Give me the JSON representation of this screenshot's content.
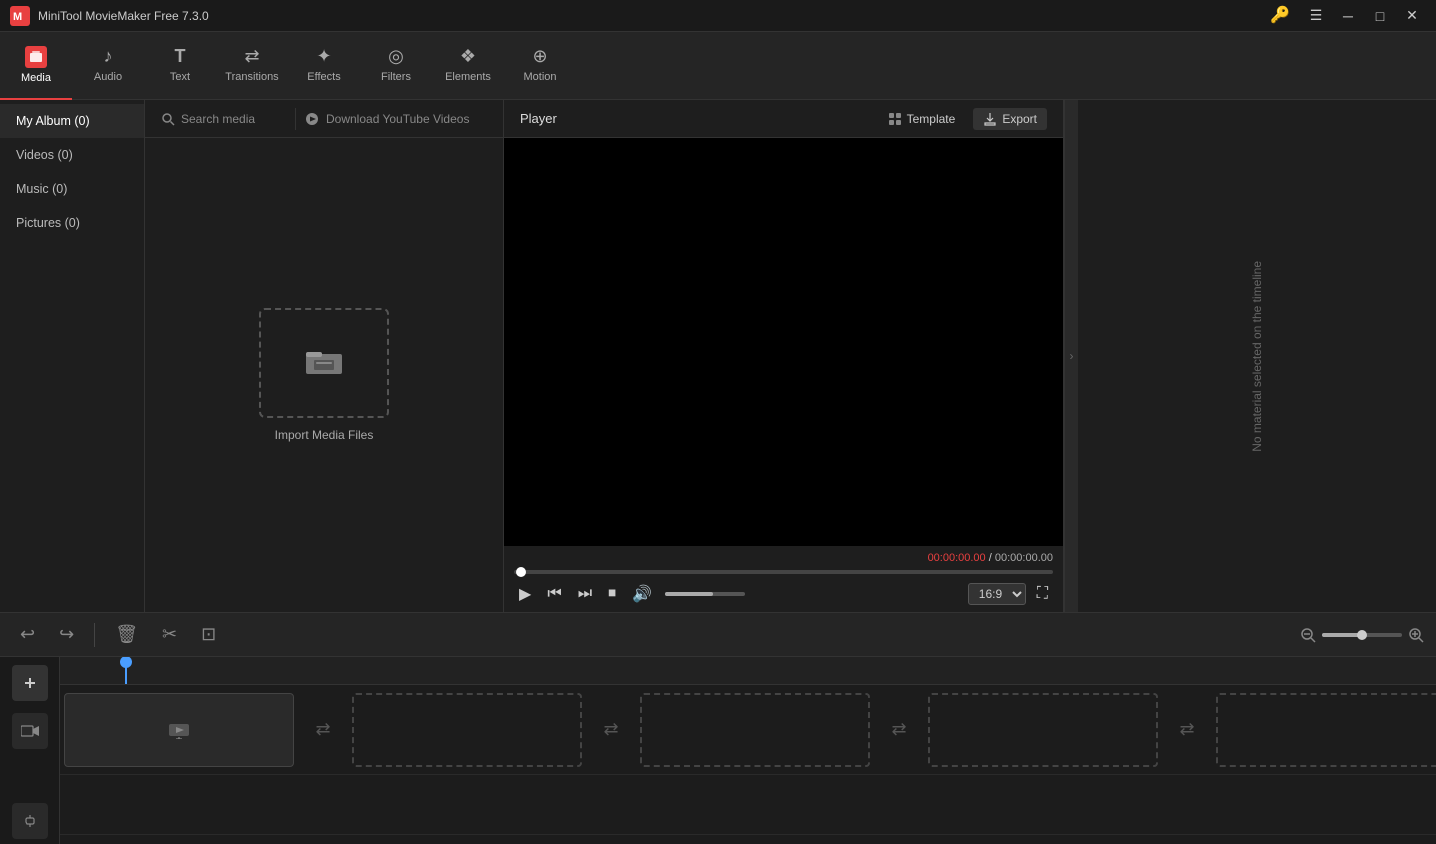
{
  "app": {
    "title": "MiniTool MovieMaker Free 7.3.0"
  },
  "titlebar": {
    "menu_icon": "☰",
    "minimize": "─",
    "maximize": "□",
    "close": "✕",
    "key_icon": "🔑"
  },
  "toolbar": {
    "items": [
      {
        "id": "media",
        "label": "Media",
        "icon": "M",
        "active": true
      },
      {
        "id": "audio",
        "label": "Audio",
        "icon": "♪"
      },
      {
        "id": "text",
        "label": "Text",
        "icon": "T"
      },
      {
        "id": "transitions",
        "label": "Transitions",
        "icon": "⇄"
      },
      {
        "id": "effects",
        "label": "Effects",
        "icon": "✦"
      },
      {
        "id": "filters",
        "label": "Filters",
        "icon": "◎"
      },
      {
        "id": "elements",
        "label": "Elements",
        "icon": "❖"
      },
      {
        "id": "motion",
        "label": "Motion",
        "icon": "⊕"
      }
    ]
  },
  "sidebar": {
    "items": [
      {
        "label": "My Album (0)",
        "active": true
      },
      {
        "label": "Videos (0)"
      },
      {
        "label": "Music (0)"
      },
      {
        "label": "Pictures (0)"
      }
    ]
  },
  "media_panel": {
    "search_placeholder": "Search media",
    "download_label": "Download YouTube Videos",
    "import_label": "Import Media Files"
  },
  "player": {
    "title": "Player",
    "template_label": "Template",
    "export_label": "Export",
    "time_current": "00:00:00.00",
    "time_separator": " / ",
    "time_total": "00:00:00.00",
    "aspect_ratio": "16:9",
    "no_material": "No material selected on the timeline"
  },
  "timeline": {
    "zoom_icon_minus": "⊖",
    "zoom_icon_plus": "⊕",
    "add_track_icon": "+",
    "undo_icon": "↩",
    "redo_icon": "↪",
    "delete_icon": "🗑",
    "scissors_icon": "✂",
    "crop_icon": "⊡"
  }
}
